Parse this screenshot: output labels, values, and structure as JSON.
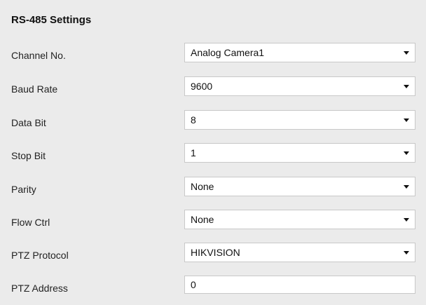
{
  "panel": {
    "title": "RS-485 Settings"
  },
  "fields": {
    "channel_no": {
      "label": "Channel No.",
      "value": "Analog Camera1"
    },
    "baud_rate": {
      "label": "Baud Rate",
      "value": "9600"
    },
    "data_bit": {
      "label": "Data Bit",
      "value": "8"
    },
    "stop_bit": {
      "label": "Stop Bit",
      "value": "1"
    },
    "parity": {
      "label": "Parity",
      "value": "None"
    },
    "flow_ctrl": {
      "label": "Flow Ctrl",
      "value": "None"
    },
    "ptz_protocol": {
      "label": "PTZ Protocol",
      "value": "HIKVISION"
    },
    "ptz_address": {
      "label": "PTZ Address",
      "value": "0"
    }
  },
  "icons": {
    "dropdown": "chevron-down-icon"
  }
}
